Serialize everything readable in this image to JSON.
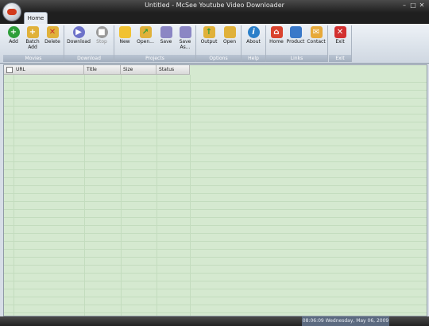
{
  "window": {
    "title": "Untitled - McSee Youtube Video Downloader"
  },
  "tabs": [
    {
      "label": "Home"
    }
  ],
  "ribbon": {
    "movies": {
      "label": "Movies",
      "add": "Add",
      "batch_add": "Batch Add",
      "delete": "Delete"
    },
    "download": {
      "label": "Download",
      "download": "Download",
      "stop": "Stop"
    },
    "projects": {
      "label": "Projects",
      "new": "New",
      "open": "Open...",
      "save": "Save",
      "save_as": "Save As..."
    },
    "options": {
      "label": "Options",
      "output": "Output",
      "open": "Open"
    },
    "help": {
      "label": "Help",
      "about": "About"
    },
    "links": {
      "label": "Links",
      "home": "Home",
      "product": "Product",
      "contact": "Contact"
    },
    "exit": {
      "label": "Exit",
      "exit": "Exit"
    }
  },
  "table": {
    "columns": [
      "URL",
      "Title",
      "Size",
      "Status"
    ]
  },
  "status": {
    "clock": "08:06:09  Wednesday, May 06, 2009"
  },
  "colors": {
    "list_bg": "#d5e9d0",
    "add": "#2e9e3a",
    "delete": "#c9302c",
    "download": "#6d72c9",
    "about": "#2a7fc9",
    "exit": "#d23030"
  }
}
